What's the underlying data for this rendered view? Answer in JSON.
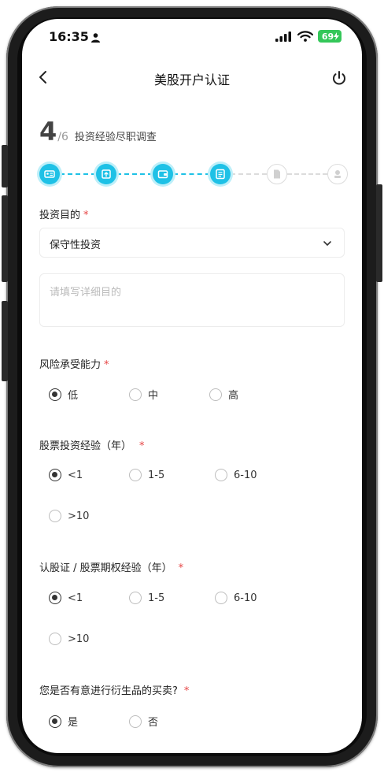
{
  "status_bar": {
    "time": "16:35",
    "battery": "69"
  },
  "nav": {
    "title": "美股开户认证"
  },
  "step": {
    "current": "4",
    "total": "/6",
    "title": "投资经验尽职调查"
  },
  "progress": {
    "total_steps": 6,
    "completed_steps": 4
  },
  "form": {
    "purpose": {
      "label": "投资目的",
      "required_mark": "*",
      "selected": "保守性投资",
      "detail_placeholder": "请填写详细目的"
    },
    "risk": {
      "label": "风险承受能力",
      "required_mark": "*",
      "options": [
        "低",
        "中",
        "高"
      ],
      "selected": "低"
    },
    "stock_exp": {
      "label": "股票投资经验（年）",
      "required_mark": "*",
      "options": [
        "<1",
        "1-5",
        "6-10",
        ">10"
      ],
      "selected": "<1"
    },
    "warrant_exp": {
      "label": "认股证 / 股票期权经验（年）",
      "required_mark": "*",
      "options": [
        "<1",
        "1-5",
        "6-10",
        ">10"
      ],
      "selected": "<1"
    },
    "derivatives": {
      "label": "您是否有意进行衍生品的买卖?",
      "required_mark": "*",
      "options": [
        "是",
        "否"
      ],
      "selected": "是"
    }
  },
  "colors": {
    "accent": "#1ec1e6",
    "required": "#e64545",
    "battery": "#34c759"
  }
}
